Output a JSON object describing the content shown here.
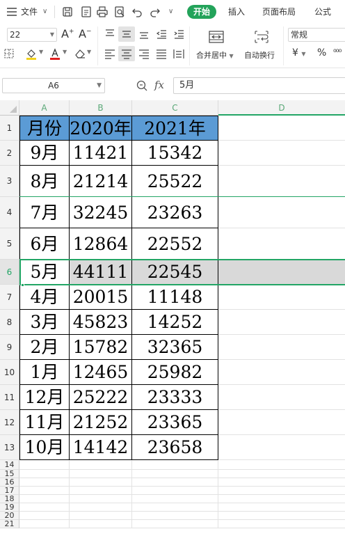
{
  "menubar": {
    "menu_label": "文件",
    "tabs": [
      {
        "label": "开始"
      },
      {
        "label": "插入"
      },
      {
        "label": "页面布局"
      },
      {
        "label": "公式"
      }
    ]
  },
  "ribbon": {
    "font_size": "22",
    "merge_center_label": "合并居中",
    "wrap_text_label": "自动换行",
    "number_format": "常规",
    "currency_symbol": "¥",
    "percent_symbol": "%"
  },
  "formula_bar": {
    "name_box": "A6",
    "fx_label": "fx",
    "content": "5月"
  },
  "sheet": {
    "columns": [
      "A",
      "B",
      "C",
      "D"
    ],
    "row_numbers": [
      "1",
      "2",
      "3",
      "4",
      "5",
      "6",
      "7",
      "8",
      "9",
      "10",
      "11",
      "12",
      "13",
      "14",
      "15",
      "16",
      "17",
      "18",
      "19",
      "20",
      "21"
    ],
    "header_row": [
      "月份",
      "2020年",
      "2021年"
    ],
    "rows": [
      [
        "9月",
        "11421",
        "15342"
      ],
      [
        "8月",
        "21214",
        "25522"
      ],
      [
        "7月",
        "32245",
        "23263"
      ],
      [
        "6月",
        "12864",
        "22552"
      ],
      [
        "5月",
        "44111",
        "22545"
      ],
      [
        "4月",
        "20015",
        "11148"
      ],
      [
        "3月",
        "45823",
        "14252"
      ],
      [
        "2月",
        "15782",
        "32365"
      ],
      [
        "1月",
        "12465",
        "25982"
      ],
      [
        "12月",
        "25222",
        "23333"
      ],
      [
        "11月",
        "21252",
        "23365"
      ],
      [
        "10月",
        "14142",
        "23658"
      ]
    ],
    "selected_cell": "A6",
    "colors": {
      "header_fill": "#5b9bd5",
      "active_accent": "#22a565",
      "selected_row_fill": "#d9d9d9"
    }
  }
}
